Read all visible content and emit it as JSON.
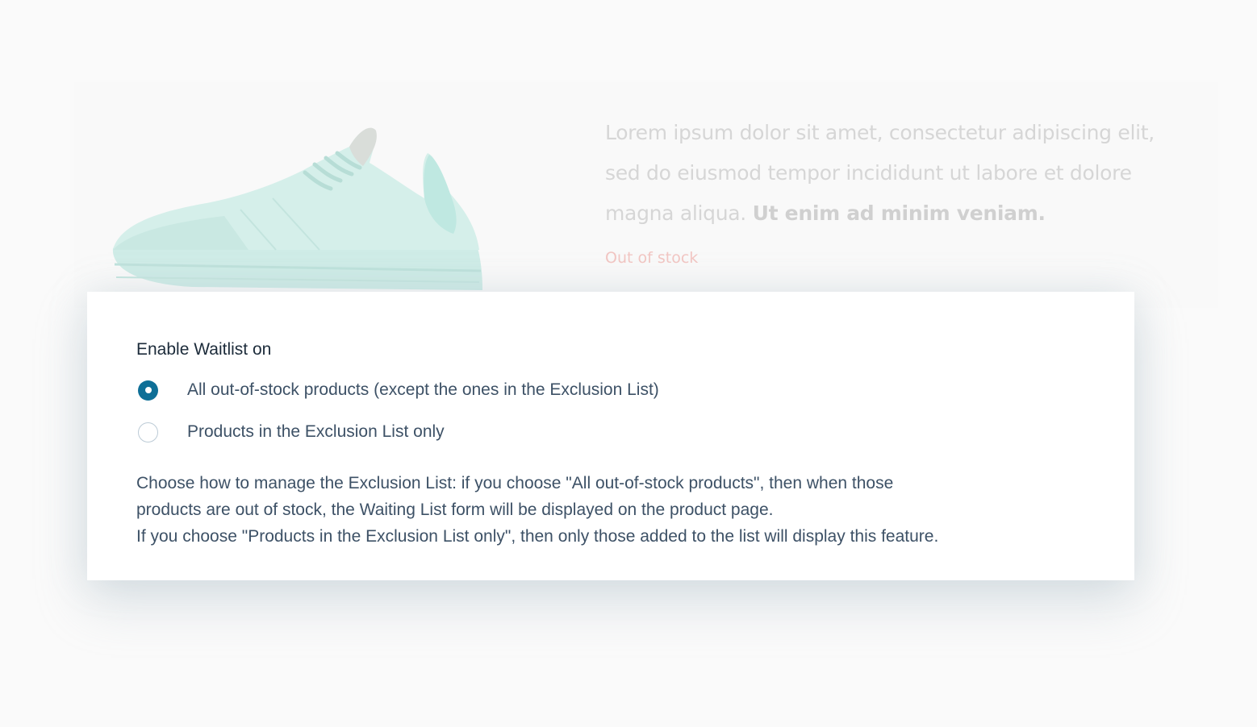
{
  "background": {
    "description_text": "Lorem ipsum dolor sit amet, consectetur adipiscing elit, sed do eiusmod tempor incididunt ut labore et dolore magna aliqua.",
    "description_bold": "Ut enim ad minim veniam.",
    "stock_status": "Out of stock",
    "product_image_icon": "sneaker-icon"
  },
  "settings": {
    "title": "Enable Waitlist on",
    "options": [
      {
        "label": "All out-of-stock products (except the ones in the Exclusion List)",
        "selected": true
      },
      {
        "label": "Products in the Exclusion List only",
        "selected": false
      }
    ],
    "help_line_1": "Choose how to manage the Exclusion List: if you choose \"All out-of-stock products\", then when those",
    "help_line_2": "products are out of stock, the Waiting List form will be displayed on the product page.",
    "help_line_3": "If you choose \"Products in the Exclusion List only\", then only those added to the list will display this feature."
  },
  "colors": {
    "accent": "#0e6f97",
    "text": "#3d5166",
    "heading": "#1c2b3a",
    "stock_status": "#f2c6c3",
    "shoe": "#cdebe6"
  }
}
